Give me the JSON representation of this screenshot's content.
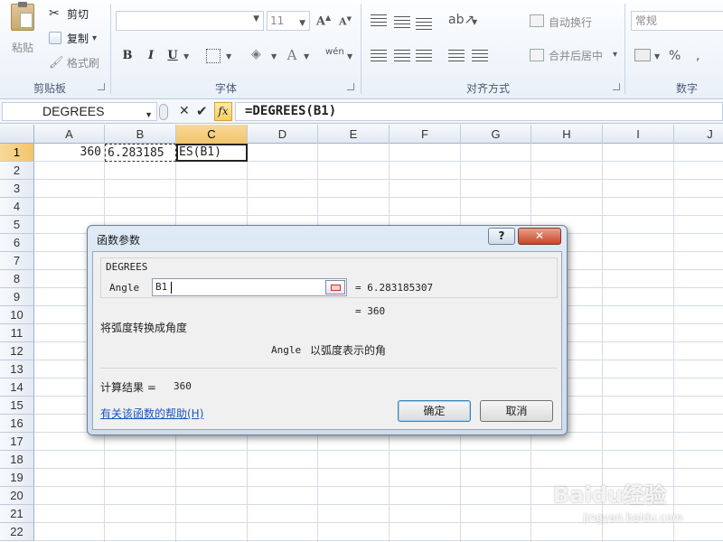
{
  "ribbon": {
    "clipboard": {
      "paste": "粘贴",
      "cut": "剪切",
      "copy": "复制",
      "copy_arrow": "▾",
      "format_painter": "格式刷",
      "group_label": "剪贴板"
    },
    "font": {
      "font_name": "",
      "font_size": "11",
      "grow": "A",
      "shrink": "A",
      "bold": "B",
      "italic": "I",
      "underline": "U",
      "color_a": "A",
      "group_label": "字体"
    },
    "alignment": {
      "wrap_text": "自动换行",
      "merge_center": "合并后居中",
      "merge_arrow": "▾",
      "group_label": "对齐方式"
    },
    "number": {
      "format": "常规",
      "percent": "%",
      "group_label": "数字"
    }
  },
  "formula_bar": {
    "name_box": "DEGREES",
    "cancel": "✕",
    "enter": "✔",
    "fx": "fx",
    "formula": "=DEGREES(B1)"
  },
  "grid": {
    "columns": [
      "A",
      "B",
      "C",
      "D",
      "E",
      "F",
      "G",
      "H",
      "I",
      "J"
    ],
    "rows": [
      "1",
      "2",
      "3",
      "4",
      "5",
      "6",
      "7",
      "8",
      "9",
      "10",
      "11",
      "12",
      "13",
      "14",
      "15",
      "16",
      "17",
      "18",
      "19",
      "20",
      "21",
      "22"
    ],
    "cells": {
      "A1": "360",
      "B1": "6.283185",
      "C1": "ES(B1)"
    }
  },
  "dialog": {
    "title": "函数参数",
    "help_btn": "?",
    "close_btn": "✕",
    "function_name": "DEGREES",
    "arg_label": "Angle",
    "arg_value": "B1",
    "arg_result": "= 6.283185307",
    "func_result": "= 360",
    "description": "将弧度转换成角度",
    "arg_desc_name": "Angle",
    "arg_desc_text": "以弧度表示的角",
    "calc_result_label": "计算结果 =",
    "calc_result_value": "360",
    "help_link": "有关该函数的帮助(H)",
    "ok": "确定",
    "cancel": "取消"
  },
  "watermark": {
    "brand": "Baidu经验",
    "url": "jingyan.baidu.com"
  }
}
